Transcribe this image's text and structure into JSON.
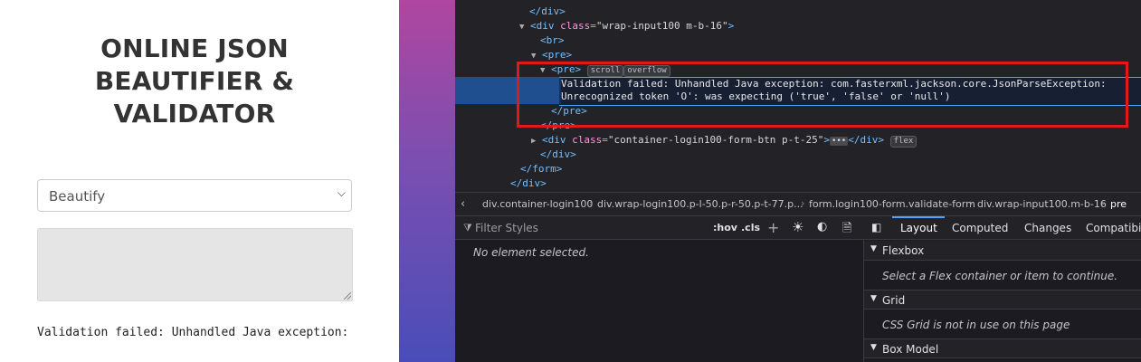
{
  "page": {
    "title_lines": [
      "ONLINE JSON",
      "BEAUTIFIER &",
      "VALIDATOR"
    ],
    "mode_select_value": "Beautify",
    "textarea_value": "",
    "result_text": "Validation failed: Unhandled Java exception:"
  },
  "devtools": {
    "tree_lines": {
      "l0_tag": "</div>",
      "l1_open": "<div",
      "l1_attr": "class",
      "l1_val": "\"wrap-input100 m-b-16\"",
      "l1_close": ">",
      "l2": "<br>",
      "l3": "<pre>",
      "l4_tag": "<pre>",
      "l4_badge1": "scroll",
      "l4_badge2": "overflow",
      "selected_line1": "Validation failed: Unhandled Java exception: com.fasterxml.jackson.core.JsonParseException:",
      "selected_line2": "Unrecognized token 'O': was expecting ('true', 'false' or 'null')",
      "l6": "</pre>",
      "l7": "</pre>",
      "l8_open": "<div",
      "l8_attr": "class",
      "l8_val": "\"container-login100-form-btn p-t-25\"",
      "l8_close": ">",
      "l8_ellipsis": "•••",
      "l8_end": "</div>",
      "l8_badge": "flex",
      "l9": "</div>",
      "l10": "</form>",
      "l11": "</div>"
    },
    "breadcrumbs": [
      "div.container-login100",
      "div.wrap-login100.p-l-50.p-r-50.p-t-77.p...",
      "form.login100-form.validate-form",
      "div.wrap-input100.m-b-16",
      "pre"
    ],
    "rules": {
      "filter_placeholder": "Filter Styles",
      "hov": ":hov",
      "cls": ".cls",
      "no_element": "No element selected."
    },
    "layout": {
      "tabs": [
        "Layout",
        "Computed",
        "Changes",
        "Compatibili"
      ],
      "sections": [
        {
          "name": "Flexbox",
          "message": "Select a Flex container or item to continue."
        },
        {
          "name": "Grid",
          "message": "CSS Grid is not in use on this page"
        },
        {
          "name": "Box Model",
          "message": ""
        }
      ]
    }
  }
}
